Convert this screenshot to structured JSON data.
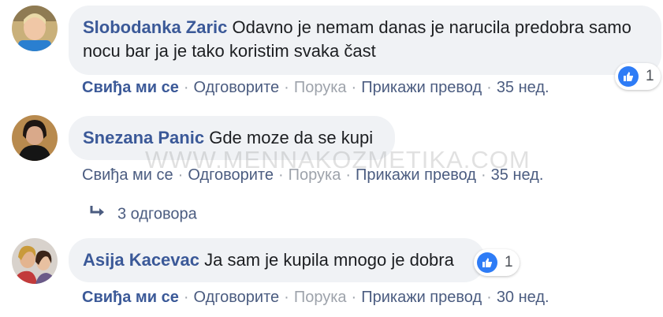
{
  "comments": [
    {
      "author": "Slobodanka Zaric",
      "text": "Odavno je nemam danas je narucila predobra samo nocu bar ja je tako koristim svaka čast",
      "actions": {
        "like": "Свиђа ми се",
        "reply": "Одговорите",
        "message": "Порука",
        "translate": "Прикажи превод",
        "time": "35 нед."
      },
      "reactions": "1"
    },
    {
      "author": "Snezana Panic",
      "text": "Gde moze da se kupi",
      "actions": {
        "like": "Свиђа ми се",
        "reply": "Одговорите",
        "message": "Порука",
        "translate": "Прикажи превод",
        "time": "35 нед."
      },
      "replies_label": "3 одговора"
    },
    {
      "author": "Asija Kacevac",
      "text": "Ja sam je kupila mnogo je dobra",
      "actions": {
        "like": "Свиђа ми се",
        "reply": "Одговорите",
        "message": "Порука",
        "translate": "Прикажи превод",
        "time": "30 нед."
      },
      "reactions": "1"
    }
  ],
  "separator": "·",
  "watermark": "WWW.MENNAKOZMETIKA.COM",
  "colors": {
    "author": "#3b5998",
    "bubble": "#f0f2f5",
    "like_icon": "#2e7cf6"
  }
}
